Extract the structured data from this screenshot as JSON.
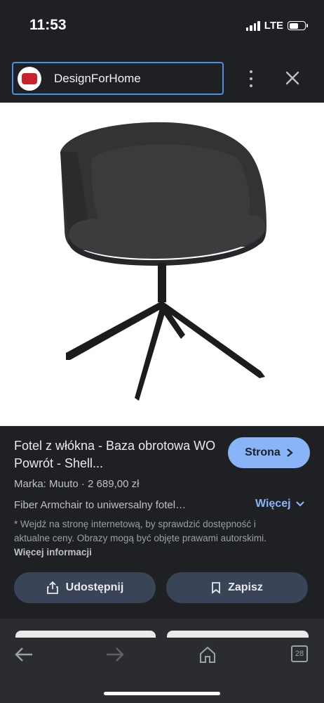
{
  "status": {
    "time": "11:53",
    "network": "LTE"
  },
  "header": {
    "site_name": "DesignForHome"
  },
  "product": {
    "title": "Fotel z włókna - Baza obrotowa WO Powrót - Shell...",
    "visit_label": "Strona",
    "brand_price": "Marka: Muuto · 2 689,00 zł",
    "description": "Fiber Armchair to uniwersalny fotel…",
    "more_label": "Więcej",
    "disclaimer": "* Wejdź na stronę internetową, by sprawdzić dostępność i aktualne ceny. Obrazy mogą być objęte prawami autorskimi.",
    "more_info_label": "Więcej informacji",
    "share_label": "Udostępnij",
    "save_label": "Zapisz"
  },
  "nav": {
    "tab_count": "28"
  },
  "colors": {
    "accent": "#8ab4f8",
    "background": "#1f2023",
    "button": "#394457"
  }
}
